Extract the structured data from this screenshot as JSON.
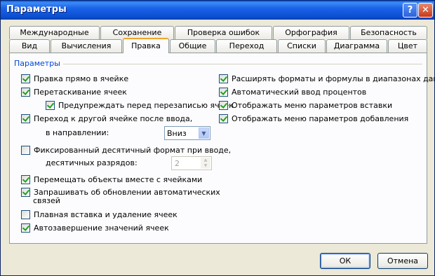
{
  "window": {
    "title": "Параметры"
  },
  "titlebar": {
    "help_label": "?",
    "close_label": "✕"
  },
  "tabs_top": [
    "Международные",
    "Сохранение",
    "Проверка ошибок",
    "Орфография",
    "Безопасность"
  ],
  "tabs_bottom": [
    "Вид",
    "Вычисления",
    "Правка",
    "Общие",
    "Переход",
    "Списки",
    "Диаграмма",
    "Цвет"
  ],
  "active_tab": "Правка",
  "group": {
    "label": "Параметры"
  },
  "left_options": [
    {
      "label": "Правка прямо в ячейке",
      "checked": true
    },
    {
      "label": "Перетаскивание ячеек",
      "checked": true
    },
    {
      "label": "Предупреждать перед перезаписью ячеек",
      "checked": true
    },
    {
      "label": "Переход к другой ячейке после ввода,",
      "checked": true
    },
    {
      "label": "Фиксированный десятичный формат при вводе,",
      "checked": false
    },
    {
      "label": "Перемещать объекты вместе с ячейками",
      "checked": true
    },
    {
      "label": "Запрашивать об обновлении автоматических",
      "checked": true
    },
    {
      "label": "Плавная вставка и удаление ячеек",
      "checked": false
    },
    {
      "label": "Автозавершение значений ячеек",
      "checked": true
    }
  ],
  "direction": {
    "label": "в направлении:",
    "value": "Вниз"
  },
  "decimals": {
    "label": "десятичных разрядов:",
    "value": "2"
  },
  "update_links_line2": "связей",
  "right_options": [
    {
      "label": "Расширять форматы и формулы в диапазонах данных",
      "checked": true
    },
    {
      "label": "Автоматический ввод процентов",
      "checked": true
    },
    {
      "label": "Отображать меню параметров вставки",
      "checked": true
    },
    {
      "label": "Отображать меню параметров добавления",
      "checked": true
    }
  ],
  "buttons": {
    "ok": "ОК",
    "cancel": "Отмена"
  },
  "colors": {
    "group_label": "#0046d5",
    "titlebar": "#0b4fd0",
    "active_tab_accent": "#f0a32c"
  }
}
